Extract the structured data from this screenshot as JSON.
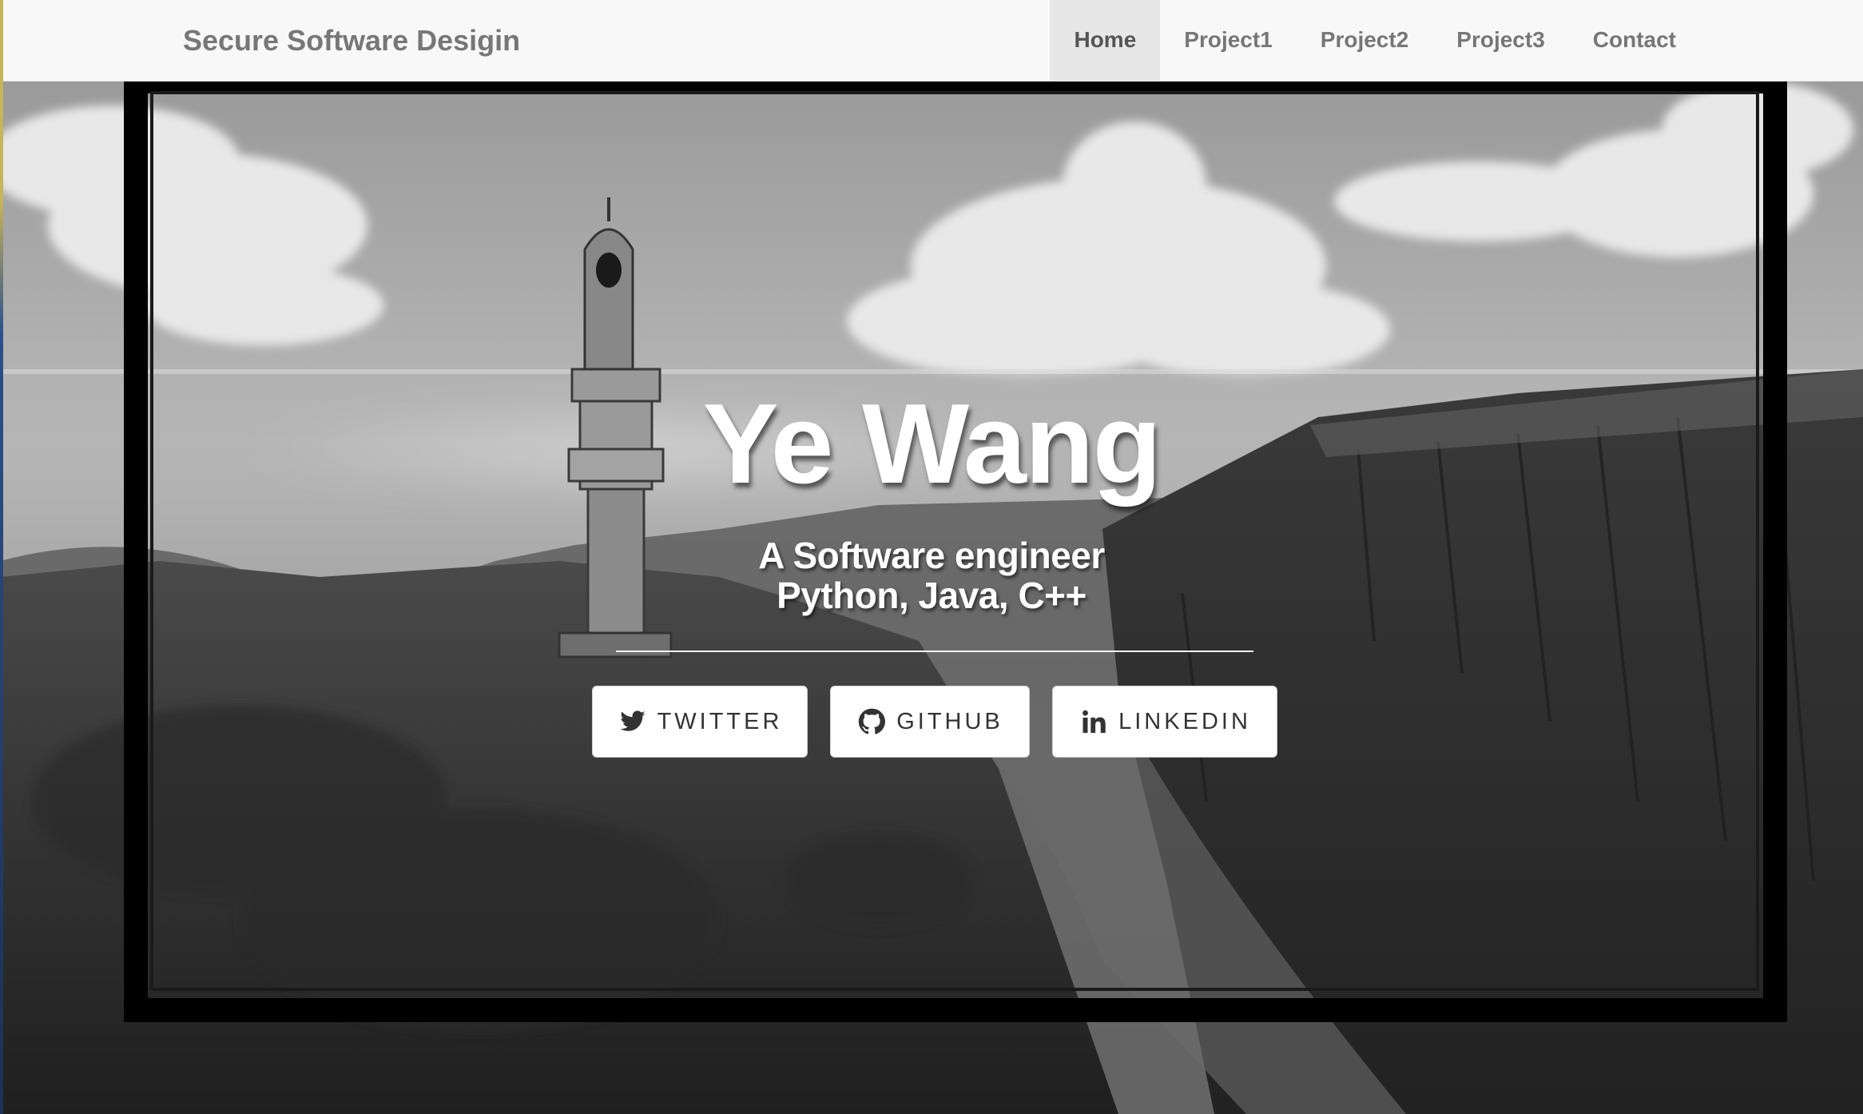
{
  "navbar": {
    "brand": "Secure Software Desigin",
    "items": [
      {
        "label": "Home",
        "active": true
      },
      {
        "label": "Project1",
        "active": false
      },
      {
        "label": "Project2",
        "active": false
      },
      {
        "label": "Project3",
        "active": false
      },
      {
        "label": "Contact",
        "active": false
      }
    ]
  },
  "hero": {
    "name": "Ye Wang",
    "tagline_line1": "A Software engineer",
    "tagline_line2": "Python, Java, C++",
    "buttons": [
      {
        "label": "TWITTER",
        "icon": "twitter-bird-icon"
      },
      {
        "label": "GITHUB",
        "icon": "github-octocat-icon"
      },
      {
        "label": "LINKEDIN",
        "icon": "linkedin-in-icon"
      }
    ],
    "background": "grayscale sketch of a lighthouse on cliffs by the sea with clouds"
  },
  "colors": {
    "navbar_bg": "#f8f8f8",
    "nav_text": "#777777",
    "nav_active_bg": "#e7e7e7",
    "hero_text": "#ffffff",
    "button_bg": "#ffffff"
  }
}
